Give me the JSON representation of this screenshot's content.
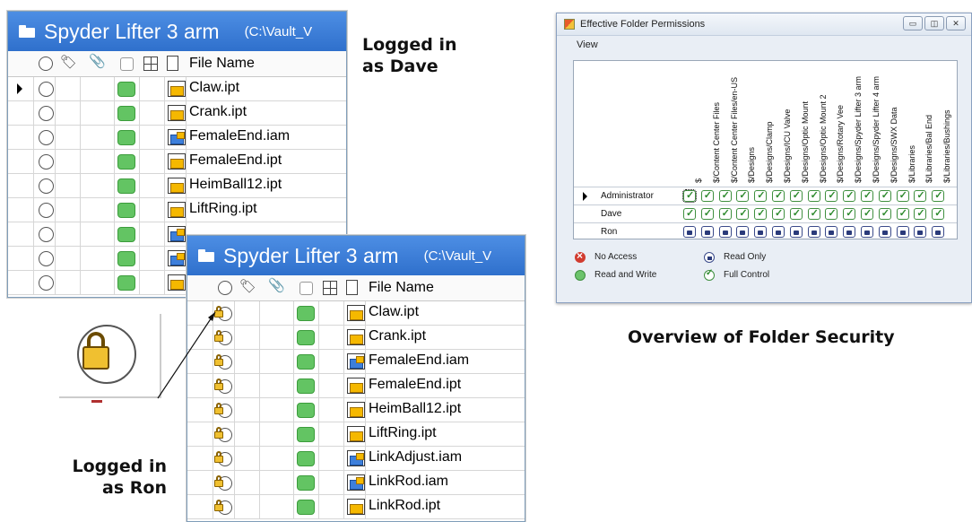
{
  "dave_pane": {
    "title": "Spyder Lifter 3 arm",
    "path": "(C:\\Vault_V",
    "column_header": "File Name",
    "files": [
      {
        "name": "Claw.ipt",
        "type": "ipt"
      },
      {
        "name": "Crank.ipt",
        "type": "ipt"
      },
      {
        "name": "FemaleEnd.iam",
        "type": "iam"
      },
      {
        "name": "FemaleEnd.ipt",
        "type": "ipt"
      },
      {
        "name": "HeimBall12.ipt",
        "type": "ipt"
      },
      {
        "name": "LiftRing.ipt",
        "type": "ipt"
      },
      {
        "name": "",
        "type": "iam"
      },
      {
        "name": "",
        "type": "iam"
      },
      {
        "name": "",
        "type": "ipt"
      }
    ]
  },
  "ron_pane": {
    "title": "Spyder Lifter 3 arm",
    "path": "(C:\\Vault_V",
    "column_header": "File Name",
    "files": [
      {
        "name": "Claw.ipt",
        "type": "ipt"
      },
      {
        "name": "Crank.ipt",
        "type": "ipt"
      },
      {
        "name": "FemaleEnd.iam",
        "type": "iam"
      },
      {
        "name": "FemaleEnd.ipt",
        "type": "ipt"
      },
      {
        "name": "HeimBall12.ipt",
        "type": "ipt"
      },
      {
        "name": "LiftRing.ipt",
        "type": "ipt"
      },
      {
        "name": "LinkAdjust.iam",
        "type": "iam"
      },
      {
        "name": "LinkRod.iam",
        "type": "iam"
      },
      {
        "name": "LinkRod.ipt",
        "type": "ipt"
      }
    ]
  },
  "labels": {
    "logged_dave_1": "Logged in",
    "logged_dave_2": "as Dave",
    "logged_ron_1": "Logged in",
    "logged_ron_2": "as Ron",
    "overview": "Overview of Folder Security"
  },
  "permissions_window": {
    "title": "Effective Folder Permissions",
    "menu_view": "View",
    "columns": [
      "$",
      "$/Content Center Files",
      "$/Content Center Files/en-US",
      "$/Designs",
      "$/Designs/Clamp",
      "$/Designs/ICU Valve",
      "$/Designs/Optic Mount",
      "$/Designs/Optic Mount 2",
      "$/Designs/Rotary Vee",
      "$/Designs/Spyder Lifter 3 arm",
      "$/Designs/Spyder Lifter 4 arm",
      "$/Designs/SWX Data",
      "$/Libraries",
      "$/Libraries/Bal End",
      "$/Libraries/Bushings"
    ],
    "rows": [
      {
        "user": "Administrator",
        "permission": "Full Control"
      },
      {
        "user": "Dave",
        "permission": "Full Control"
      },
      {
        "user": "Ron",
        "permission": "Read Only"
      }
    ],
    "legend": {
      "no_access": "No Access",
      "read_only": "Read Only",
      "read_write": "Read and Write",
      "full_control": "Full Control"
    }
  },
  "colors": {
    "title_bar": "#3c7fd8",
    "status_green": "#63c463",
    "lock_yellow": "#f0c030",
    "no_access_red": "#d13b2f"
  }
}
